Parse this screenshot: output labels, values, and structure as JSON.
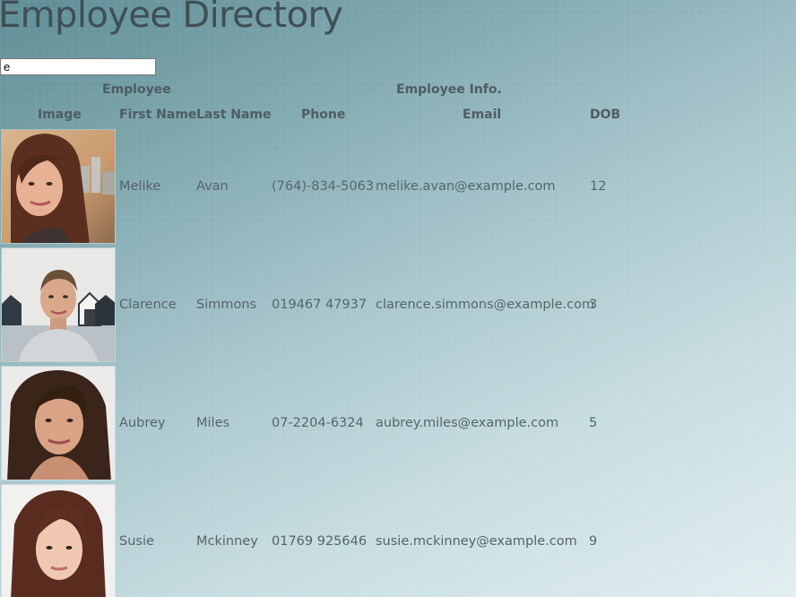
{
  "header": {
    "title": "Employee Directory"
  },
  "search": {
    "value": "e"
  },
  "table": {
    "group_headers": {
      "employee": "Employee",
      "info": "Employee Info."
    },
    "columns": {
      "image": "Image",
      "first_name": "First Name",
      "last_name": "Last Name",
      "phone": "Phone",
      "email": "Email",
      "dob": "DOB"
    },
    "rows": [
      {
        "first": "Melike",
        "last": "Avan",
        "phone": "(764)-834-5063",
        "email": "melike.avan@example.com",
        "dob": "12"
      },
      {
        "first": "Clarence",
        "last": "Simmons",
        "phone": "019467 47937",
        "email": "clarence.simmons@example.com",
        "dob": "3"
      },
      {
        "first": "Aubrey",
        "last": "Miles",
        "phone": "07-2204-6324",
        "email": "aubrey.miles@example.com",
        "dob": "5"
      },
      {
        "first": "Susie",
        "last": "Mckinney",
        "phone": "01769 925646",
        "email": "susie.mckinney@example.com",
        "dob": "9"
      }
    ]
  }
}
